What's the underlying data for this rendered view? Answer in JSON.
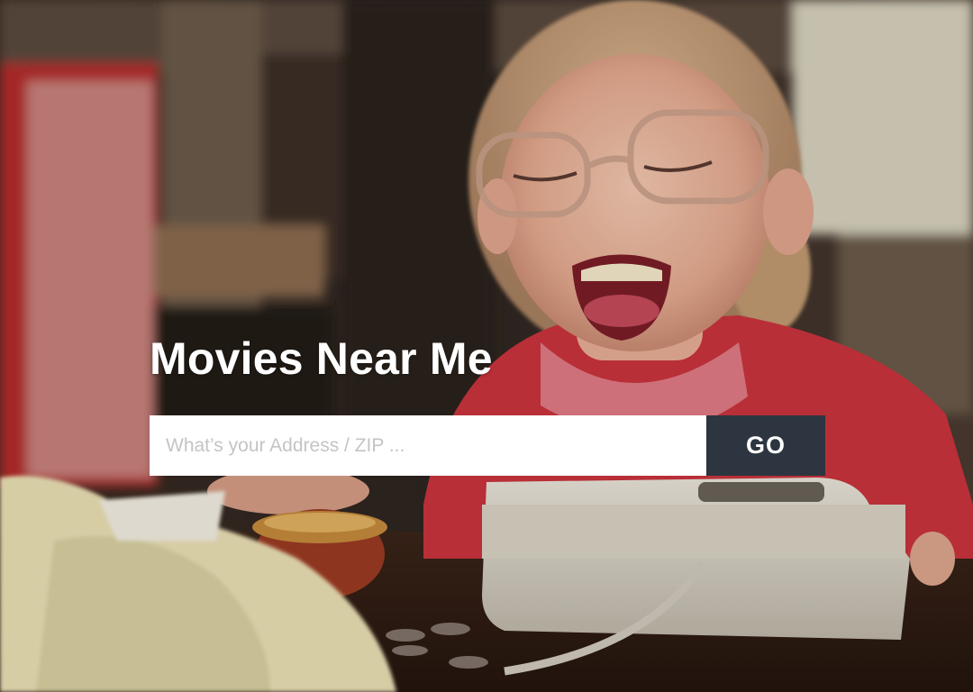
{
  "hero": {
    "title": "Movies Near Me",
    "image_subject": "laughing-girl-with-glasses-photo"
  },
  "search": {
    "placeholder": "What’s your Address / ZIP ...",
    "value": "",
    "button_label": "GO"
  },
  "colors": {
    "button_bg": "#2d3640",
    "title_text": "#ffffff",
    "input_bg": "#ffffff",
    "placeholder_text": "#c4c4c4"
  }
}
